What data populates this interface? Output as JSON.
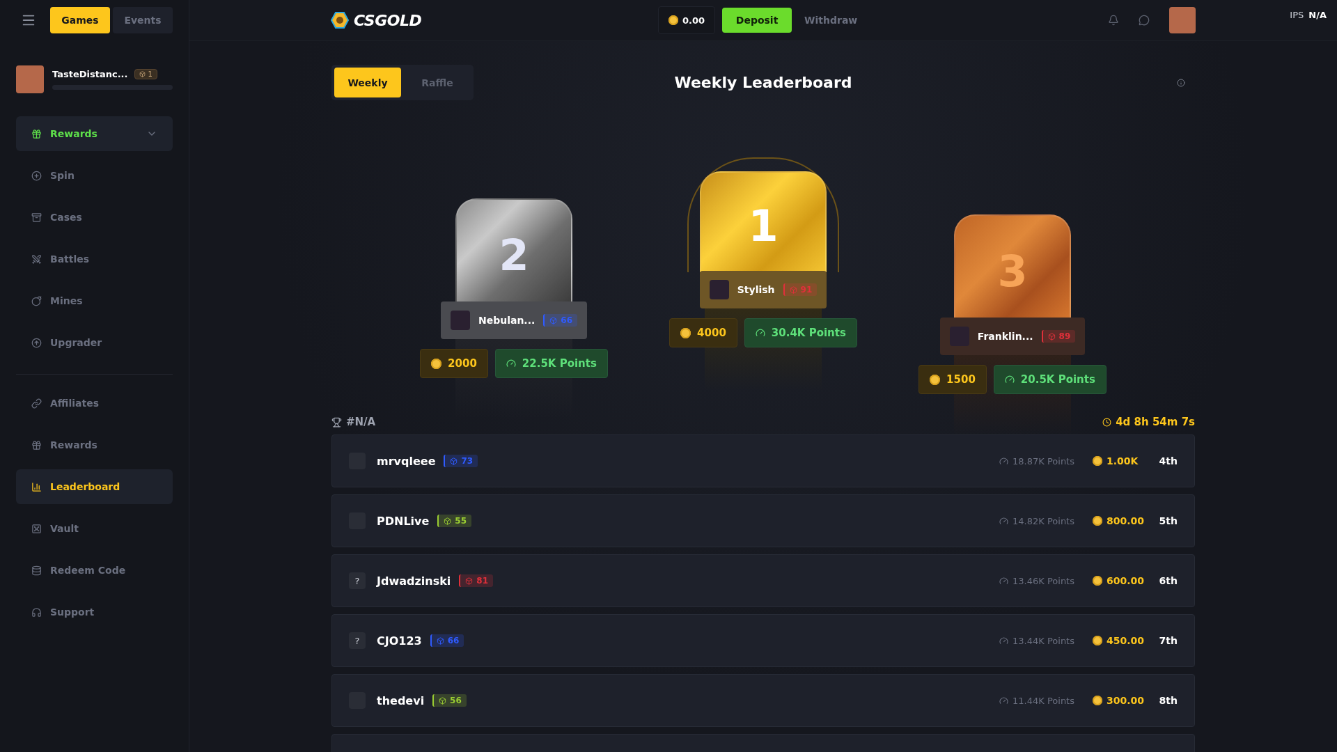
{
  "sidebar": {
    "menu_tabs": [
      {
        "label": "Games",
        "selected": true
      },
      {
        "label": "Events",
        "selected": false
      }
    ],
    "user": {
      "name": "TasteDistanc...",
      "level": "1",
      "xp": {
        "level": 0
      }
    },
    "nav_groups": [
      {
        "items": [
          {
            "label": "Rewards",
            "kind": "group",
            "expanded": false
          },
          {
            "label": "Spin",
            "kind": "link",
            "selected": false
          },
          {
            "label": "Cases",
            "kind": "link",
            "selected": false
          },
          {
            "label": "Battles",
            "kind": "link",
            "selected": false
          },
          {
            "label": "Mines",
            "kind": "link",
            "selected": false
          },
          {
            "label": "Upgrader",
            "kind": "link",
            "selected": false
          }
        ]
      },
      {
        "items": [
          {
            "label": "Affiliates",
            "kind": "link",
            "selected": false
          },
          {
            "label": "Rewards",
            "kind": "link",
            "selected": false
          },
          {
            "label": "Leaderboard",
            "kind": "link",
            "selected": true
          },
          {
            "label": "Vault",
            "kind": "link",
            "selected": false
          },
          {
            "label": "Redeem Code",
            "kind": "link",
            "selected": false
          },
          {
            "label": "Support",
            "kind": "link",
            "selected": false
          }
        ]
      }
    ]
  },
  "topbar": {
    "logo": "CSGOLD",
    "balance": "0.00",
    "deposit": "Deposit",
    "withdraw": "Withdraw",
    "ips_label": "IPS",
    "ips_value": "N/A"
  },
  "leaderboard": {
    "tabs": [
      {
        "label": "Weekly",
        "selected": true
      },
      {
        "label": "Raffle",
        "selected": false
      }
    ],
    "title": "Weekly Leaderboard",
    "podium": [
      {
        "kind": "silver",
        "rank": "2",
        "name": "Nebulan...",
        "level": "66",
        "color": "#2f5bff",
        "prize": "2000",
        "points": "22.5K Points"
      },
      {
        "kind": "gold",
        "rank": "1",
        "name": "Stylish",
        "level": "91",
        "color": "#e0303a",
        "prize": "4000",
        "points": "30.4K Points"
      },
      {
        "kind": "bronze",
        "rank": "3",
        "name": "Franklin...",
        "level": "89",
        "color": "#e0303a",
        "prize": "1500",
        "points": "20.5K Points"
      }
    ],
    "my_rank": "#N/A",
    "timer": "4d 8h 54m 7s",
    "rows": [
      {
        "name": "mrvqleee",
        "level": "73",
        "color": "#2f5bff",
        "points": "18.87K Points",
        "prize": "1.00K",
        "place": "4th"
      },
      {
        "name": "PDNLive",
        "level": "55",
        "color": "#9acd32",
        "points": "14.82K Points",
        "prize": "800.00",
        "place": "5th"
      },
      {
        "avatar_text": "?",
        "name": "Jdwadzinski",
        "level": "81",
        "color": "#e0303a",
        "points": "13.46K Points",
        "prize": "600.00",
        "place": "6th"
      },
      {
        "avatar_text": "?",
        "name": "CJO123",
        "level": "66",
        "color": "#2f5bff",
        "points": "13.44K Points",
        "prize": "450.00",
        "place": "7th"
      },
      {
        "name": "thedevi",
        "level": "56",
        "color": "#9acd32",
        "points": "11.44K Points",
        "prize": "300.00",
        "place": "8th"
      }
    ]
  }
}
